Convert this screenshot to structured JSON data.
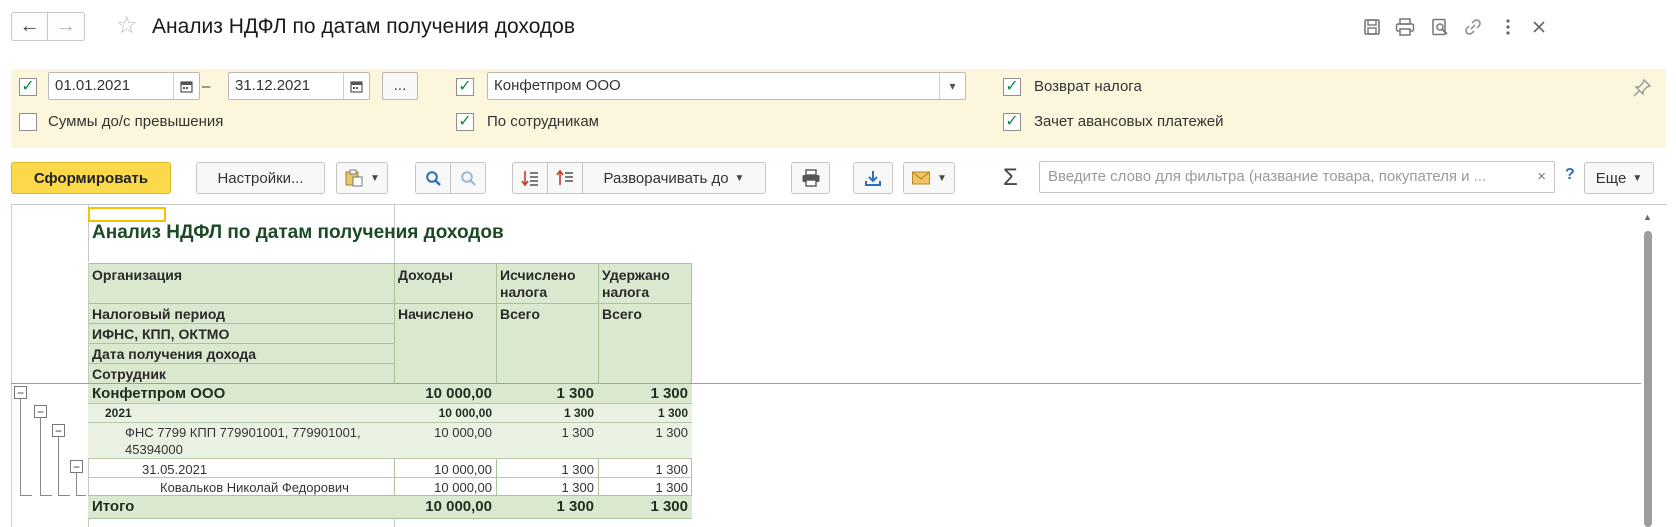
{
  "window": {
    "title": "Анализ НДФЛ по датам получения доходов",
    "back_icon": "←",
    "forward_icon": "→",
    "favorite_icon": "☆"
  },
  "titlebar_icons": [
    "save-icon",
    "print-icon",
    "preview-icon",
    "link-icon",
    "more-icon",
    "close-icon"
  ],
  "filters": {
    "period_enabled": true,
    "date_from": "01.01.2021",
    "date_separator": "–",
    "date_to": "31.12.2021",
    "period_button": "...",
    "org_enabled": true,
    "organization": "Конфетпром ООО",
    "tax_refund_label": "Возврат налога",
    "tax_refund_checked": true,
    "sums_exceed_label": "Суммы до/с превышения",
    "sums_exceed_checked": false,
    "by_employees_label": "По сотрудникам",
    "by_employees_checked": true,
    "advance_offset_label": "Зачет авансовых платежей",
    "advance_offset_checked": true
  },
  "toolbar": {
    "generate_label": "Сформировать",
    "settings_label": "Настройки...",
    "expand_label": "Разворачивать до",
    "search_placeholder": "Введите слово для фильтра (название товара, покупателя и ...",
    "search_clear": "×",
    "help": "?",
    "more_label": "Еще"
  },
  "report": {
    "title": "Анализ НДФЛ по датам получения доходов",
    "headers": {
      "organization": "Организация",
      "tax_period": "Налоговый период",
      "ifns": "ИФНС, КПП, ОКТМО",
      "income_date": "Дата получения дохода",
      "employee": "Сотрудник",
      "income": "Доходы",
      "income_sub": "Начислено",
      "calculated": "Исчислено налога",
      "calculated_sub": "Всего",
      "withheld": "Удержано налога",
      "withheld_sub": "Всего"
    },
    "rows": [
      {
        "label": "Конфетпром ООО",
        "income": "10 000,00",
        "calc": "1 300",
        "withheld": "1 300"
      },
      {
        "label": "2021",
        "income": "10 000,00",
        "calc": "1 300",
        "withheld": "1 300"
      },
      {
        "label": "ФНС 7799 КПП 779901001, 779901001,",
        "label2": "45394000",
        "income": "10 000,00",
        "calc": "1 300",
        "withheld": "1 300"
      },
      {
        "label": "31.05.2021",
        "income": "10 000,00",
        "calc": "1 300",
        "withheld": "1 300"
      },
      {
        "label": "Ковальков Николай Федорович",
        "income": "10 000,00",
        "calc": "1 300",
        "withheld": "1 300"
      }
    ],
    "total": {
      "label": "Итого",
      "income": "10 000,00",
      "calc": "1 300",
      "withheld": "1 300"
    },
    "collapse_symbol": "−"
  }
}
